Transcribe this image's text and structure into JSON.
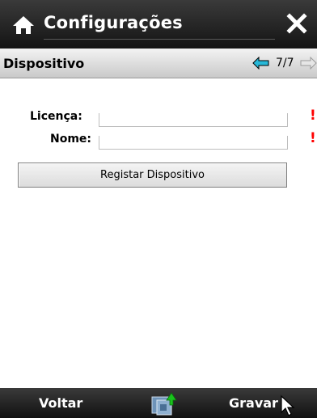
{
  "header": {
    "title": "Configurações",
    "home_icon": "home-icon",
    "close_icon": "close-icon"
  },
  "section": {
    "title": "Dispositivo",
    "page_indicator": "7/7",
    "prev_icon": "arrow-left-icon",
    "next_icon": "arrow-right-icon"
  },
  "form": {
    "fields": [
      {
        "label": "Licença:",
        "value": "",
        "required_mark": "!"
      },
      {
        "label": "Nome:",
        "value": "",
        "required_mark": "!"
      }
    ],
    "register_button": "Registar Dispositivo"
  },
  "footer": {
    "back_label": "Voltar",
    "save_label": "Gravar",
    "sync_icon": "sync-icon"
  },
  "colors": {
    "bar_dark": "#1e1e1e",
    "arrow_cyan": "#27b8d8",
    "required": "#ff0000"
  }
}
